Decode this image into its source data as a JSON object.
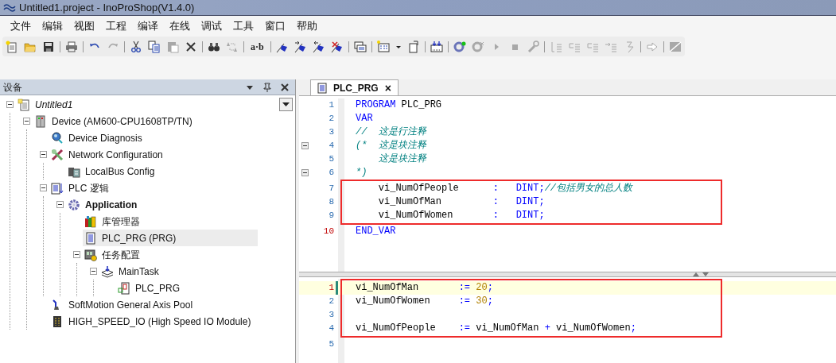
{
  "window": {
    "title": "Untitled1.project - InoProShop(V1.4.0)"
  },
  "menu": [
    "文件",
    "编辑",
    "视图",
    "工程",
    "编译",
    "在线",
    "调试",
    "工具",
    "窗口",
    "帮助"
  ],
  "toolbar": [
    [
      {
        "kind": "new",
        "disabled": false
      },
      {
        "kind": "open",
        "disabled": false
      },
      {
        "kind": "save",
        "disabled": false
      }
    ],
    [
      {
        "kind": "print",
        "disabled": false
      }
    ],
    [
      {
        "kind": "undo",
        "disabled": false
      },
      {
        "kind": "redo",
        "disabled": true
      }
    ],
    [
      {
        "kind": "cut",
        "disabled": false
      },
      {
        "kind": "copy",
        "disabled": false
      },
      {
        "kind": "paste",
        "disabled": true
      },
      {
        "kind": "delete",
        "disabled": false
      }
    ],
    [
      {
        "kind": "find",
        "disabled": false
      },
      {
        "kind": "replace",
        "disabled": true
      }
    ],
    [
      {
        "kind": "text",
        "label": "a·b",
        "disabled": false
      }
    ],
    [
      {
        "kind": "bookmark",
        "disabled": false
      },
      {
        "kind": "bookmark-next",
        "disabled": false
      },
      {
        "kind": "bookmark-prev",
        "disabled": false
      },
      {
        "kind": "bookmark-clear",
        "disabled": false
      }
    ],
    [
      {
        "kind": "windows",
        "disabled": false
      }
    ],
    [
      {
        "kind": "table",
        "disabled": false
      },
      {
        "kind": "caret",
        "disabled": false
      },
      {
        "kind": "page",
        "disabled": false
      }
    ],
    [
      {
        "kind": "download",
        "disabled": false
      }
    ],
    [
      {
        "kind": "login",
        "disabled": false
      },
      {
        "kind": "logout",
        "disabled": true
      },
      {
        "kind": "start",
        "disabled": true
      },
      {
        "kind": "stop",
        "disabled": true
      },
      {
        "kind": "wrench",
        "disabled": true
      }
    ],
    [
      {
        "kind": "step-over",
        "disabled": true
      },
      {
        "kind": "step-into",
        "disabled": true
      },
      {
        "kind": "step-out",
        "disabled": true
      },
      {
        "kind": "run-to",
        "disabled": true
      },
      {
        "kind": "show-next",
        "disabled": true
      }
    ],
    [
      {
        "kind": "arrow",
        "disabled": true
      }
    ],
    [
      {
        "kind": "grid",
        "disabled": true
      }
    ]
  ],
  "devices_panel": {
    "title": "设备",
    "tree": [
      {
        "label": "Untitled1",
        "kind": "project",
        "italic": true,
        "bold": false,
        "selected": false,
        "expanded": true,
        "children": [
          {
            "label": "Device (AM600-CPU1608TP/TN)",
            "kind": "device",
            "italic": false,
            "bold": false,
            "selected": false,
            "expanded": true,
            "children": [
              {
                "label": "Device Diagnosis",
                "kind": "diagnosis",
                "italic": false,
                "bold": false,
                "selected": false
              },
              {
                "label": "Network Configuration",
                "kind": "network",
                "italic": false,
                "bold": false,
                "selected": false,
                "expanded": true,
                "children": [
                  {
                    "label": "LocalBus Config",
                    "kind": "localbus",
                    "italic": false,
                    "bold": false,
                    "selected": false
                  }
                ]
              },
              {
                "label": "PLC 逻辑",
                "kind": "plc",
                "italic": false,
                "bold": false,
                "selected": false,
                "expanded": true,
                "children": [
                  {
                    "label": "Application",
                    "kind": "application",
                    "italic": false,
                    "bold": true,
                    "selected": false,
                    "expanded": true,
                    "children": [
                      {
                        "label": "库管理器",
                        "kind": "library",
                        "italic": false,
                        "bold": false,
                        "selected": false
                      },
                      {
                        "label": "PLC_PRG (PRG)",
                        "kind": "pou",
                        "italic": false,
                        "bold": false,
                        "selected": true
                      },
                      {
                        "label": "任务配置",
                        "kind": "taskconfig",
                        "italic": false,
                        "bold": false,
                        "selected": false,
                        "expanded": true,
                        "children": [
                          {
                            "label": "MainTask",
                            "kind": "task",
                            "italic": false,
                            "bold": false,
                            "selected": false,
                            "expanded": true,
                            "children": [
                              {
                                "label": "PLC_PRG",
                                "kind": "call",
                                "italic": false,
                                "bold": false,
                                "selected": false
                              }
                            ]
                          }
                        ]
                      }
                    ]
                  }
                ]
              },
              {
                "label": "SoftMotion General Axis Pool",
                "kind": "axis",
                "italic": false,
                "bold": false,
                "selected": false
              },
              {
                "label": "HIGH_SPEED_IO (High Speed IO Module)",
                "kind": "io",
                "italic": false,
                "bold": false,
                "selected": false
              }
            ]
          }
        ]
      }
    ]
  },
  "editor": {
    "tab": {
      "label": "PLC_PRG",
      "close": "×"
    },
    "declaration": [
      {
        "number": "1",
        "marked": false,
        "fold": false,
        "current": false,
        "highlighted": false,
        "segments": [
          {
            "kind": "keyword",
            "text": "PROGRAM"
          },
          {
            "kind": "plain",
            "text": " PLC_PRG"
          }
        ]
      },
      {
        "number": "2",
        "marked": false,
        "fold": false,
        "current": false,
        "highlighted": false,
        "segments": [
          {
            "kind": "keyword",
            "text": "VAR"
          }
        ]
      },
      {
        "number": "3",
        "marked": false,
        "fold": false,
        "current": false,
        "highlighted": false,
        "segments": [
          {
            "kind": "comment",
            "text": "//  这是行注释"
          }
        ]
      },
      {
        "number": "4",
        "marked": false,
        "fold": true,
        "current": false,
        "highlighted": false,
        "segments": [
          {
            "kind": "comment",
            "text": "(*  这是块注释"
          }
        ]
      },
      {
        "number": "5",
        "marked": false,
        "fold": false,
        "current": false,
        "highlighted": false,
        "segments": [
          {
            "kind": "comment",
            "text": "    这是块注释"
          }
        ]
      },
      {
        "number": "6",
        "marked": false,
        "fold": true,
        "current": false,
        "highlighted": false,
        "segments": [
          {
            "kind": "comment",
            "text": "*)"
          }
        ]
      },
      {
        "number": "7",
        "marked": false,
        "fold": false,
        "current": false,
        "highlighted": true,
        "segments": [
          {
            "kind": "plain",
            "text": "    vi_NumOfPeople      "
          },
          {
            "kind": "operator",
            "text": ":"
          },
          {
            "kind": "keyword",
            "text": "   DINT"
          },
          {
            "kind": "operator",
            "text": ";"
          },
          {
            "kind": "comment",
            "text": "//包括男女的总人数"
          }
        ]
      },
      {
        "number": "8",
        "marked": false,
        "fold": false,
        "current": false,
        "highlighted": true,
        "segments": [
          {
            "kind": "plain",
            "text": "    vi_NumOfMan         "
          },
          {
            "kind": "operator",
            "text": ":"
          },
          {
            "kind": "keyword",
            "text": "   DINT"
          },
          {
            "kind": "operator",
            "text": ";"
          }
        ]
      },
      {
        "number": "9",
        "marked": false,
        "fold": false,
        "current": false,
        "highlighted": true,
        "segments": [
          {
            "kind": "plain",
            "text": "    vi_NumOfWomen       "
          },
          {
            "kind": "operator",
            "text": ":"
          },
          {
            "kind": "keyword",
            "text": "   DINT"
          },
          {
            "kind": "operator",
            "text": ";"
          }
        ]
      },
      {
        "number": "10",
        "marked": true,
        "fold": false,
        "current": false,
        "highlighted": false,
        "segments": [
          {
            "kind": "keyword",
            "text": "END_VAR"
          }
        ]
      }
    ],
    "implementation": [
      {
        "number": "1",
        "marked": true,
        "fold": false,
        "current": true,
        "highlighted": true,
        "segments": [
          {
            "kind": "plain",
            "text": "vi_NumOfMan       "
          },
          {
            "kind": "operator",
            "text": ":="
          },
          {
            "kind": "number",
            "text": " 20"
          },
          {
            "kind": "operator",
            "text": ";"
          }
        ]
      },
      {
        "number": "2",
        "marked": false,
        "fold": false,
        "current": false,
        "highlighted": true,
        "segments": [
          {
            "kind": "plain",
            "text": "vi_NumOfWomen     "
          },
          {
            "kind": "operator",
            "text": ":="
          },
          {
            "kind": "number",
            "text": " 30"
          },
          {
            "kind": "operator",
            "text": ";"
          }
        ]
      },
      {
        "number": "3",
        "marked": false,
        "fold": false,
        "current": false,
        "highlighted": true
      },
      {
        "number": "4",
        "marked": false,
        "fold": false,
        "current": false,
        "highlighted": true,
        "segments": [
          {
            "kind": "plain",
            "text": "vi_NumOfPeople    "
          },
          {
            "kind": "operator",
            "text": ":="
          },
          {
            "kind": "plain",
            "text": " vi_NumOfMan "
          },
          {
            "kind": "operator",
            "text": "+"
          },
          {
            "kind": "plain",
            "text": " vi_NumOfWomen"
          },
          {
            "kind": "operator",
            "text": ";"
          }
        ]
      },
      {
        "number": "5",
        "marked": false,
        "fold": false,
        "current": false,
        "highlighted": false
      }
    ]
  }
}
